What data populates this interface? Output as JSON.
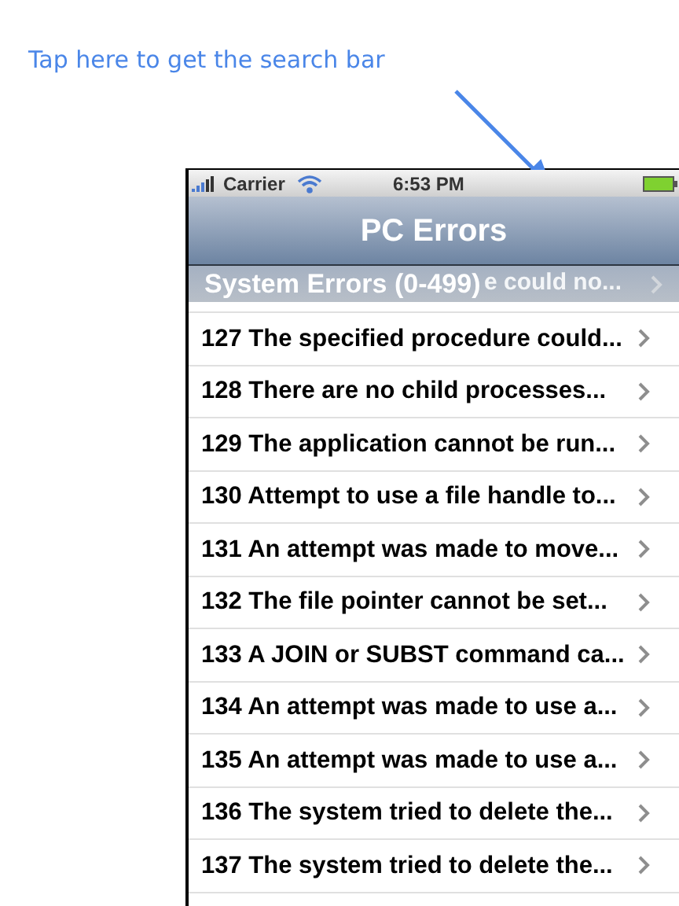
{
  "annotation": {
    "text": "Tap here to get the search bar"
  },
  "status_bar": {
    "carrier": "Carrier",
    "time": "6:53 PM"
  },
  "nav_bar": {
    "title": "PC Errors"
  },
  "section": {
    "title": "System Errors (0-499)",
    "hidden_row_text": "e could no..."
  },
  "rows": [
    {
      "text": "127 The specified procedure could..."
    },
    {
      "text": "128 There are no child processes..."
    },
    {
      "text": "129 The application cannot be run..."
    },
    {
      "text": "130 Attempt to use a file handle to..."
    },
    {
      "text": "131 An attempt was made to move..."
    },
    {
      "text": "132 The file pointer cannot be set..."
    },
    {
      "text": "133 A JOIN or SUBST command ca..."
    },
    {
      "text": "134 An attempt was made to use a..."
    },
    {
      "text": "135 An attempt was made to use a..."
    },
    {
      "text": "136 The system tried to delete the..."
    },
    {
      "text": "137 The system tried to delete the..."
    }
  ]
}
